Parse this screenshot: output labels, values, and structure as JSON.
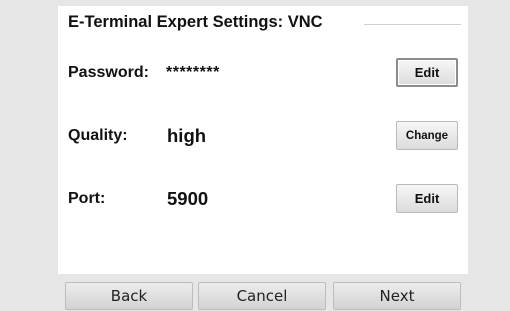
{
  "header": {
    "title": "E-Terminal Expert Settings: VNC"
  },
  "settings": {
    "password": {
      "label": "Password:",
      "value": "********",
      "button": "Edit"
    },
    "quality": {
      "label": "Quality:",
      "value": "high",
      "button": "Change"
    },
    "port": {
      "label": "Port:",
      "value": "5900",
      "button": "Edit"
    }
  },
  "footer": {
    "back": "Back",
    "cancel": "Cancel",
    "next": "Next"
  }
}
